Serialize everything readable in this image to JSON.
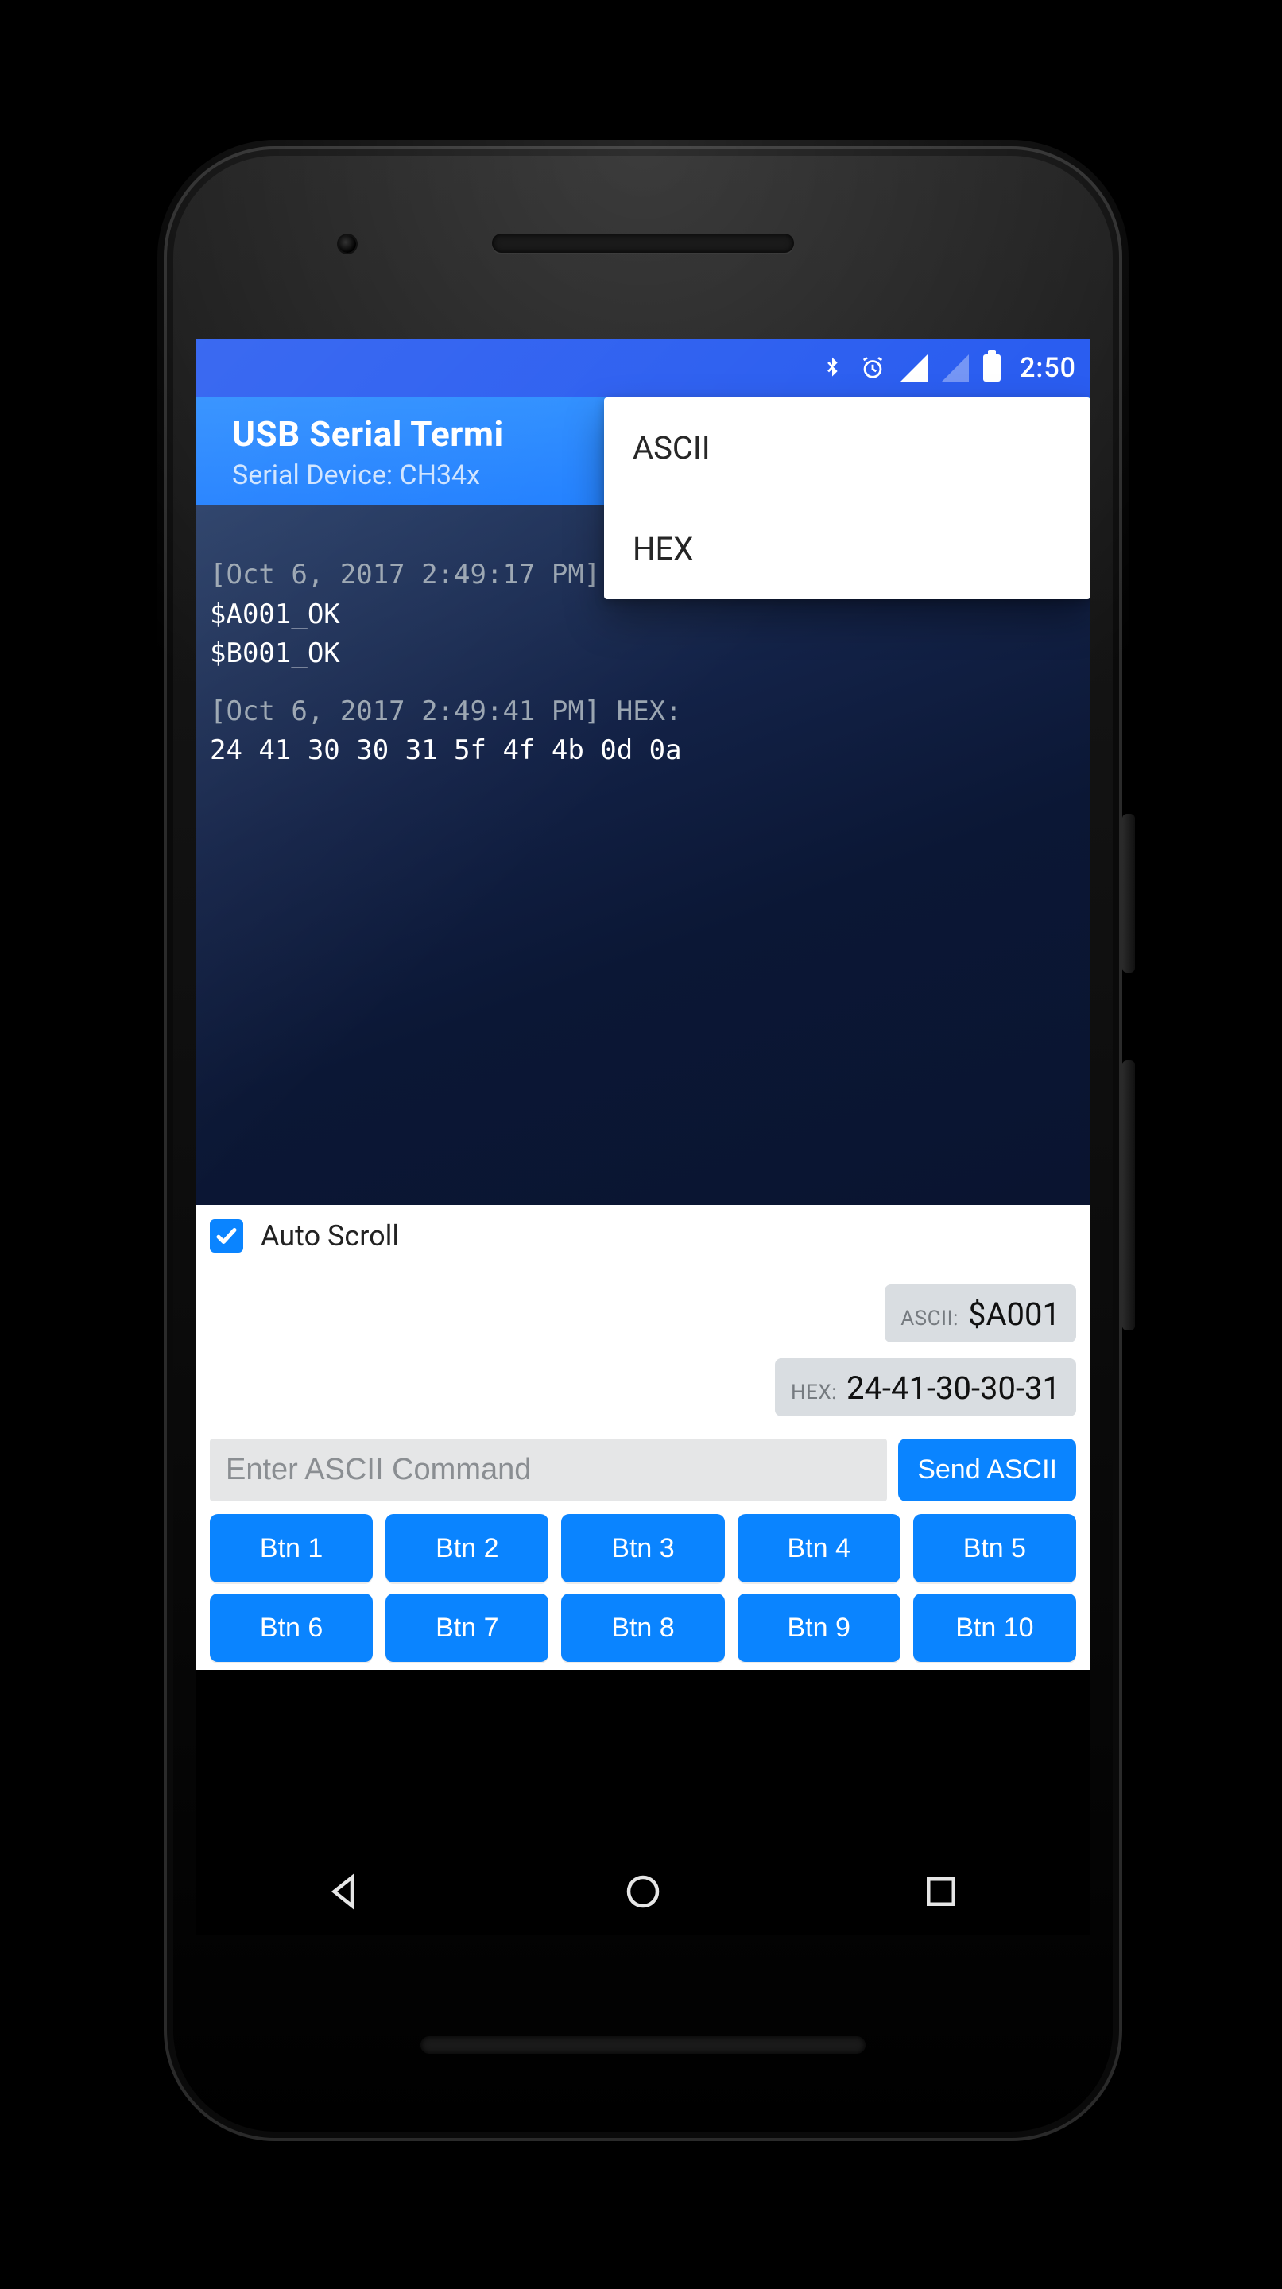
{
  "status": {
    "time": "2:50"
  },
  "appbar": {
    "title": "USB Serial Termi",
    "subtitle": "Serial Device: CH34x"
  },
  "menu": {
    "items": [
      "ASCII",
      "HEX"
    ]
  },
  "log": {
    "l1_meta": "[Oct 6, 2017 2:49:17 PM] ",
    "l1_a": "$A001_OK",
    "l1_b": "$B001_OK",
    "l2_meta": "[Oct 6, 2017 2:49:41 PM] HEX:",
    "l2_hex": "24 41 30 30 31 5f 4f 4b 0d 0a"
  },
  "autoscroll": {
    "label": "Auto Scroll",
    "checked": true
  },
  "last": {
    "ascii_tag": "ASCII:",
    "ascii_val": "$A001",
    "hex_tag": "HEX:",
    "hex_val": "24-41-30-30-31"
  },
  "cmd": {
    "placeholder": "Enter ASCII Command",
    "send_label": "Send ASCII"
  },
  "buttons": [
    "Btn 1",
    "Btn 2",
    "Btn 3",
    "Btn 4",
    "Btn 5",
    "Btn 6",
    "Btn 7",
    "Btn 8",
    "Btn 9",
    "Btn 10"
  ]
}
